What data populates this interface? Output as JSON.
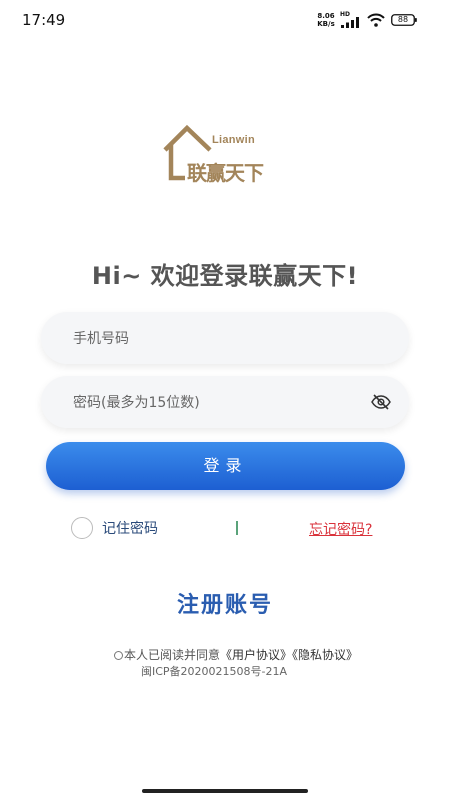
{
  "status_bar": {
    "time": "17:49",
    "net_speed_value": "8.06",
    "net_speed_unit": "KB/s",
    "network_type": "HD",
    "battery_level": "88"
  },
  "logo": {
    "latin_text": "Lianwin",
    "chinese_text": "联赢天下"
  },
  "welcome_text": "Hi~ 欢迎登录联赢天下!",
  "form": {
    "phone_placeholder": "手机号码",
    "phone_value": "",
    "password_placeholder": "密码(最多为15位数)",
    "password_value": "",
    "login_label": "登录",
    "remember_label": "记住密码",
    "remember_checked": false,
    "forgot_label": "忘记密码?"
  },
  "register_label": "注册账号",
  "agreement": {
    "prefix": "本人已阅读并同意",
    "user_agreement": "《用户协议》",
    "privacy_policy": "《隐私协议》",
    "icp": "闽ICP备2020021508号-21A"
  },
  "colors": {
    "primary": "#1d5fd2",
    "brand_gold": "#a3855a",
    "link_red": "#d9323b",
    "register_blue": "#2a5db0"
  },
  "icons": {
    "eye": "eye-off-icon",
    "signal": "signal-icon",
    "wifi": "wifi-icon",
    "battery": "battery-icon"
  }
}
